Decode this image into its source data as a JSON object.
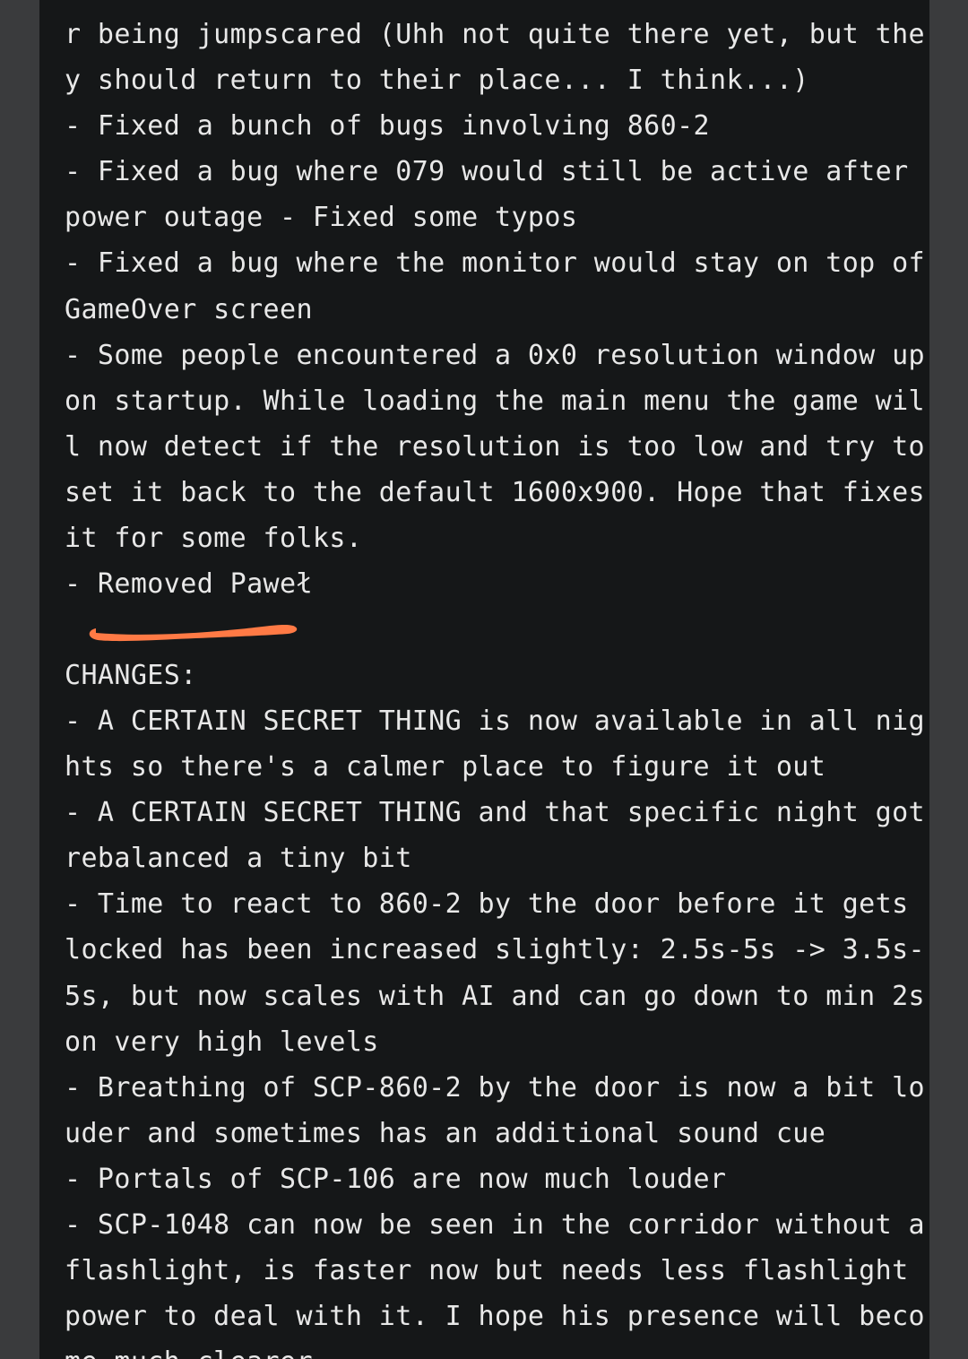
{
  "changelog": {
    "fixes_lines": [
      "r being jumpscared (Uhh not quite there yet, but the",
      "y should return to their place... I think...)",
      "- Fixed a bunch of bugs involving 860-2",
      "- Fixed a bug where 079 would still be active after",
      "power outage - Fixed some typos",
      "- Fixed a bug where the monitor would stay on top of",
      "GameOver screen",
      "- Some people encountered a 0x0 resolution window up",
      "on startup. While loading the main menu the game wil",
      "l now detect if the resolution is too low and try to",
      "set it back to the default 1600x900. Hope that fixes",
      "it for some folks.",
      "- Removed Paweł"
    ],
    "changes_heading": "CHANGES:",
    "changes_lines": [
      "- A CERTAIN SECRET THING is now available in all nig",
      "hts so there's a calmer place to figure it out",
      "- A CERTAIN SECRET THING and that specific night got",
      "rebalanced a tiny bit",
      "- Time to react to 860-2 by the door before it gets",
      "locked has been increased slightly: 2.5s-5s -> 3.5s-",
      "5s, but now scales with AI and can go down to min 2s",
      "on very high levels",
      "- Breathing of SCP-860-2 by the door is now a bit lo",
      "uder and sometimes has an additional sound cue",
      "- Portals of SCP-106 are now much louder",
      "- SCP-1048 can now be seen in the corridor without a",
      "flashlight, is faster now but needs less flashlight",
      "power to deal with it. I hope his presence will beco",
      "me much clearer"
    ]
  },
  "colors": {
    "panel_background": "#151718",
    "page_background": "#3a3b3d",
    "text": "#e8e8e8",
    "highlight_stroke": "#ff7a45"
  }
}
